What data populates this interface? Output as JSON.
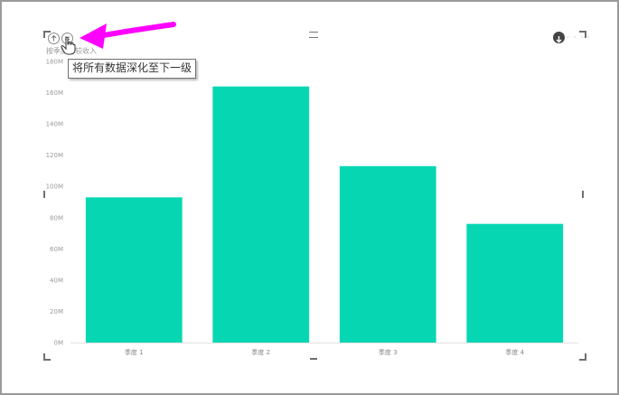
{
  "visual": {
    "title": "按季度比较收入",
    "tooltip_text": "将所有数据深化至下一级",
    "more_options": "· · · ·"
  },
  "icons": {
    "drill_up": "arrow-up-circle-icon",
    "drill_down_all": "double-chevron-down-circle-icon",
    "drill_mode": "arrow-down-circle-icon",
    "cursor": "hand-pointer-icon",
    "callout": "magenta-arrow-icon",
    "grip": "drag-grip-icon"
  },
  "colors": {
    "bar": "#06D7B2",
    "callout_arrow": "#FF00FF",
    "axis_text": "#9A9A9A"
  },
  "chart_data": {
    "type": "bar",
    "title": "按季度比较收入",
    "categories": [
      "季度 1",
      "季度 2",
      "季度 3",
      "季度 4"
    ],
    "values": [
      93000000,
      164000000,
      113000000,
      76000000
    ],
    "ylim": [
      0,
      180000000
    ],
    "yticks": [
      0,
      20000000,
      40000000,
      60000000,
      80000000,
      100000000,
      120000000,
      140000000,
      160000000,
      180000000
    ],
    "ytick_labels": [
      "0M",
      "20M",
      "40M",
      "60M",
      "80M",
      "100M",
      "120M",
      "140M",
      "160M",
      "180M"
    ],
    "xlabel": "",
    "ylabel": "",
    "grid": false,
    "legend": "none"
  }
}
